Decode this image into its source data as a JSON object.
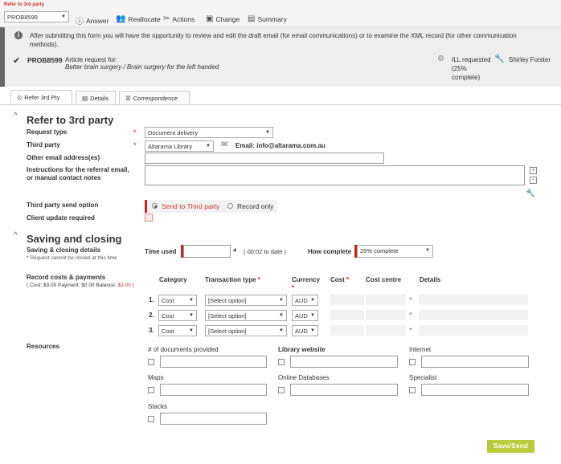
{
  "header": {
    "breadcrumb": "Refer to 3rd party",
    "request_id_select": "PROB8599",
    "toolbar": [
      {
        "label": "Answer",
        "icon": "info-icon"
      },
      {
        "label": "Reallocate",
        "icon": "users-icon"
      },
      {
        "label": "Actions",
        "icon": "tools-icon"
      },
      {
        "label": "Change",
        "icon": "edit-icon"
      },
      {
        "label": "Summary",
        "icon": "list-icon"
      }
    ]
  },
  "info": {
    "notice": "After submitting this form you will have the opportunity to review and edit the draft email (for email communications) or to examine the XML record (for other communication methods).",
    "request_id": "PROB8599",
    "article_label": "Article request for:",
    "article_title": "Better brain surgery / Brain surgery for the left handed",
    "status_line1": "ILL requested",
    "status_line2": "(25%",
    "status_line3": "complete)",
    "assignee": "Shirley Forster"
  },
  "tabs": [
    {
      "label": "Refer 3rd Pty",
      "icon": "arrow-circle-icon",
      "active": true
    },
    {
      "label": "Details",
      "icon": "details-icon",
      "active": false
    },
    {
      "label": "Correspondence",
      "icon": "correspondence-icon",
      "active": false
    }
  ],
  "refer": {
    "title": "Refer to 3rd party",
    "request_type_label": "Request type",
    "request_type_value": "Document delivery",
    "third_party_label": "Third party",
    "third_party_value": "Altarama Library",
    "email_label": "Email: info@altarama.com.au",
    "other_email_label": "Other email address(es)",
    "instructions_label1": "Instructions for the referral email,",
    "instructions_label2": "or manual contact notes",
    "send_option_label": "Third party send option",
    "send_option_1": "Send to Third party",
    "send_option_2": "Record only",
    "client_update_label": "Client update required"
  },
  "saving": {
    "title": "Saving and closing",
    "details_label": "Saving & closing details",
    "details_note": "* Request cannot be closed at this time",
    "time_used_label": "Time used",
    "time_to_date": "( 00:02 to date )",
    "how_complete_label": "How complete",
    "how_complete_value": "25% complete",
    "record_costs_label": "Record costs & payments",
    "cost_summary": "( Cost: $3.00    Payment: $0.00    Balance: ",
    "balance_value": "$3.00",
    "cost_summary_end": " )",
    "col_category": "Category",
    "col_transaction": "Transaction type",
    "col_currency": "Currency",
    "col_cost": "Cost",
    "col_cost_centre": "Cost centre",
    "col_details": "Details",
    "rows": [
      {
        "num": "1.",
        "category": "Cost",
        "transaction": "[Select option]",
        "currency": "AUD"
      },
      {
        "num": "2.",
        "category": "Cost",
        "transaction": "[Select option]",
        "currency": "AUD"
      },
      {
        "num": "3.",
        "category": "Cost",
        "transaction": "[Select option]",
        "currency": "AUD"
      }
    ],
    "resources_label": "Resources",
    "resources": [
      "# of documents provided",
      "Library website",
      "Internet",
      "Maps",
      "Online Databases",
      "Specialist",
      "Stacks"
    ],
    "save_button": "Save/Send"
  }
}
